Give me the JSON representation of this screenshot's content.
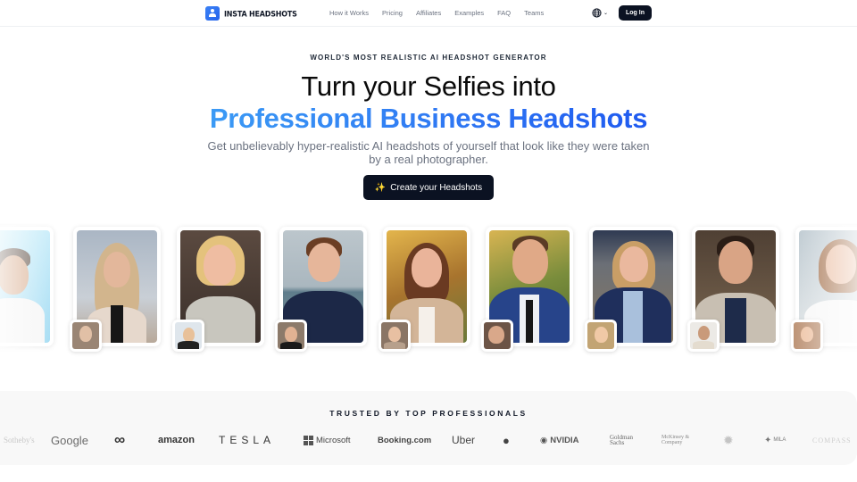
{
  "nav": {
    "brand": "INSTA HEADSHOTS",
    "links": [
      "How it Works",
      "Pricing",
      "Affiliates",
      "Examples",
      "FAQ",
      "Teams"
    ],
    "language_icon": "globe-icon",
    "login_label": "Log In"
  },
  "hero": {
    "eyebrow": "WORLD'S MOST REALISTIC AI HEADSHOT GENERATOR",
    "title_line1": "Turn your Selfies into",
    "title_line2": "Professional Business Headshots",
    "subtitle": "Get unbelievably hyper-realistic AI headshots of yourself that look like they were taken by a real photographer.",
    "cta_label": "Create your Headshots",
    "cta_icon": "sparkles-icon",
    "accent_gradient": [
      "#3b9af5",
      "#1f5af0"
    ]
  },
  "gallery": {
    "examples": [
      {
        "subject": "man in white shirt, light blue background"
      },
      {
        "subject": "blonde woman, city skyline"
      },
      {
        "subject": "blonde woman with bob, office"
      },
      {
        "subject": "man with glasses, beach"
      },
      {
        "subject": "brunette woman in beige blazer, autumn park"
      },
      {
        "subject": "man in blue suit, park"
      },
      {
        "subject": "woman with glasses in navy blazer, office"
      },
      {
        "subject": "bearded man in grey blazer, cafe"
      },
      {
        "subject": "smiling woman in white blouse"
      }
    ]
  },
  "trusted": {
    "title": "TRUSTED BY TOP PROFESSIONALS",
    "logos": [
      "Sotheby's",
      "Google",
      "Meta",
      "amazon",
      "TESLA",
      "Microsoft",
      "Booking.com",
      "Uber",
      "Apple",
      "NVIDIA",
      "Goldman Sachs",
      "McKinsey & Company",
      "Seal",
      "MILA",
      "COMPASS"
    ]
  }
}
